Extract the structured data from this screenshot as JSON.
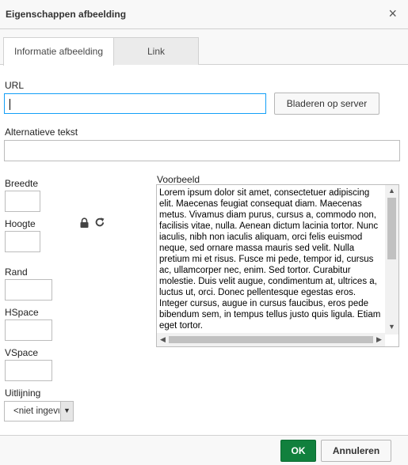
{
  "dialog": {
    "title": "Eigenschappen afbeelding",
    "close_symbol": "×"
  },
  "tabs": [
    {
      "label": "Informatie afbeelding",
      "active": true
    },
    {
      "label": "Link",
      "active": false
    }
  ],
  "url": {
    "label": "URL",
    "value": "",
    "browse_button": "Bladeren op server"
  },
  "alt": {
    "label": "Alternatieve tekst",
    "value": ""
  },
  "width": {
    "label": "Breedte",
    "value": ""
  },
  "height": {
    "label": "Hoogte",
    "value": ""
  },
  "border": {
    "label": "Rand",
    "value": ""
  },
  "hspace": {
    "label": "HSpace",
    "value": ""
  },
  "vspace": {
    "label": "VSpace",
    "value": ""
  },
  "align": {
    "label": "Uitlijning",
    "selected": "<niet ingevuld>"
  },
  "preview": {
    "label": "Voorbeeld",
    "text": "Lorem ipsum dolor sit amet, consectetuer adipiscing elit. Maecenas feugiat consequat diam. Maecenas metus. Vivamus diam purus, cursus a, commodo non, facilisis vitae, nulla. Aenean dictum lacinia tortor. Nunc iaculis, nibh non iaculis aliquam, orci felis euismod neque, sed ornare massa mauris sed velit. Nulla pretium mi et risus. Fusce mi pede, tempor id, cursus ac, ullamcorper nec, enim. Sed tortor. Curabitur molestie. Duis velit augue, condimentum at, ultrices a, luctus ut, orci. Donec pellentesque egestas eros. Integer cursus, augue in cursus faucibus, eros pede bibendum sem, in tempus tellus justo quis ligula. Etiam eget tortor."
  },
  "footer": {
    "ok": "OK",
    "cancel": "Annuleren"
  },
  "colors": {
    "ok_bg": "#11803d",
    "focus_border": "#139ff7"
  },
  "icons": {
    "lock": "lock-icon",
    "reset": "reset-size-icon"
  }
}
